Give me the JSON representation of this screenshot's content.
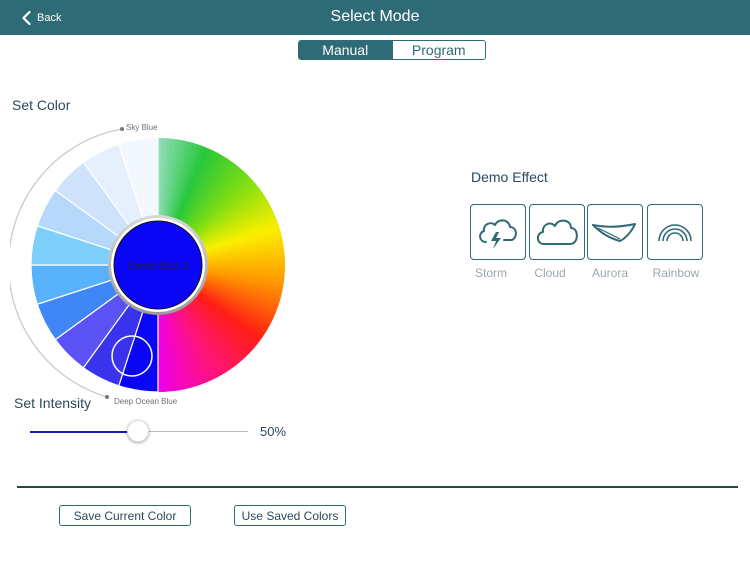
{
  "nav": {
    "back_label": "Back",
    "title": "Select Mode"
  },
  "mode_tabs": {
    "manual": "Manual",
    "program": "Program",
    "active": "Manual"
  },
  "set_color": {
    "label": "Set Color",
    "selected_color_name": "Ocean Blue 2",
    "selected_color": "#0a06f5",
    "top_label": "Sky Blue",
    "bottom_label": "Deep Ocean Blue"
  },
  "intensity": {
    "label": "Set Intensity",
    "value_percent": 50,
    "value_text": "50%"
  },
  "demo_effect": {
    "label": "Demo Effect",
    "items": [
      {
        "label": "Storm",
        "icon": "storm-cloud-icon"
      },
      {
        "label": "Cloud",
        "icon": "cloud-icon"
      },
      {
        "label": "Aurora",
        "icon": "aurora-icon"
      },
      {
        "label": "Rainbow",
        "icon": "rainbow-icon"
      }
    ]
  },
  "actions": {
    "save_label": "Save Current Color",
    "use_saved_label": "Use Saved Colors"
  },
  "colors": {
    "accent": "#2f6b76",
    "divider": "#244a3c"
  }
}
